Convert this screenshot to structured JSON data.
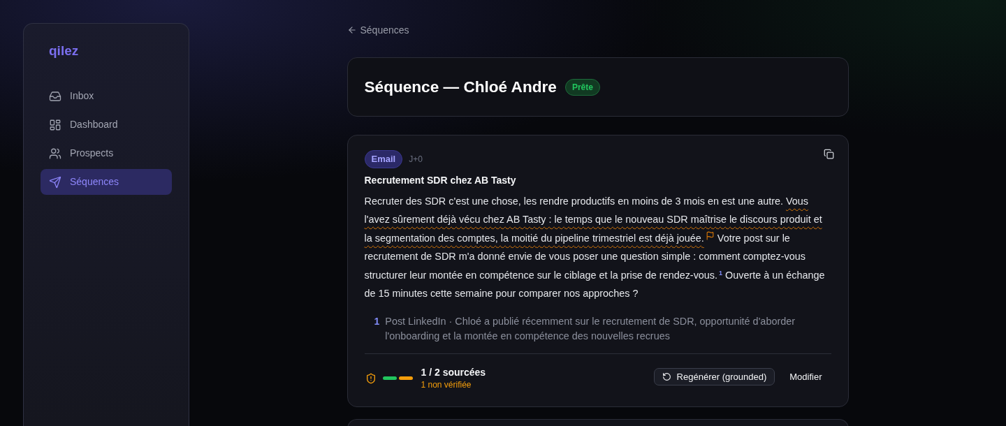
{
  "sidebar": {
    "logo": "qilez",
    "items": [
      {
        "label": "Inbox",
        "selected": false
      },
      {
        "label": "Dashboard",
        "selected": false
      },
      {
        "label": "Prospects",
        "selected": false
      },
      {
        "label": "Séquences",
        "selected": true
      }
    ]
  },
  "back_link": {
    "label": "Séquences"
  },
  "header": {
    "title": "Séquence — Chloé Andre",
    "status": "Prête"
  },
  "steps": [
    {
      "channel": "Email",
      "delay": "J+0",
      "subject": "Recrutement SDR chez AB Tasty",
      "body": [
        {
          "kind": "text",
          "text": "Recruter des SDR c'est une chose, les rendre productifs en moins de 3 mois en est une autre. "
        },
        {
          "kind": "unverified",
          "text": "Vous l'avez sûrement déjà vécu chez AB Tasty : le temps que le nouveau SDR maîtrise le discours produit et la segmentation des comptes, la moitié du pipeline trimestriel est déjà jouée."
        },
        {
          "kind": "text",
          "text": " Votre post sur le recrutement de SDR m'a donné envie de vous poser une question simple : comment comptez-vous structurer leur montée en compétence sur le ciblage et la prise de rendez-vous."
        },
        {
          "kind": "citation",
          "text": "1"
        },
        {
          "kind": "text",
          "text": " Ouverte à un échange de 15 minutes cette semaine pour comparer nos approches ?"
        }
      ],
      "sources": [
        {
          "number": "1",
          "text": "Post LinkedIn · Chloé a publié récemment sur le recrutement de SDR, opportunité d'aborder l'onboarding et la montée en compétence des nouvelles recrues"
        }
      ],
      "verification": {
        "bars": [
          {
            "verified": true
          },
          {
            "verified": false
          }
        ],
        "summary": "1 / 2 sourcées",
        "warning": "1 non vérifiée"
      },
      "actions": [
        {
          "kind": "outlined",
          "label": "Regénérer (grounded)"
        },
        {
          "kind": "plain",
          "label": "Modifier"
        }
      ]
    }
  ]
}
